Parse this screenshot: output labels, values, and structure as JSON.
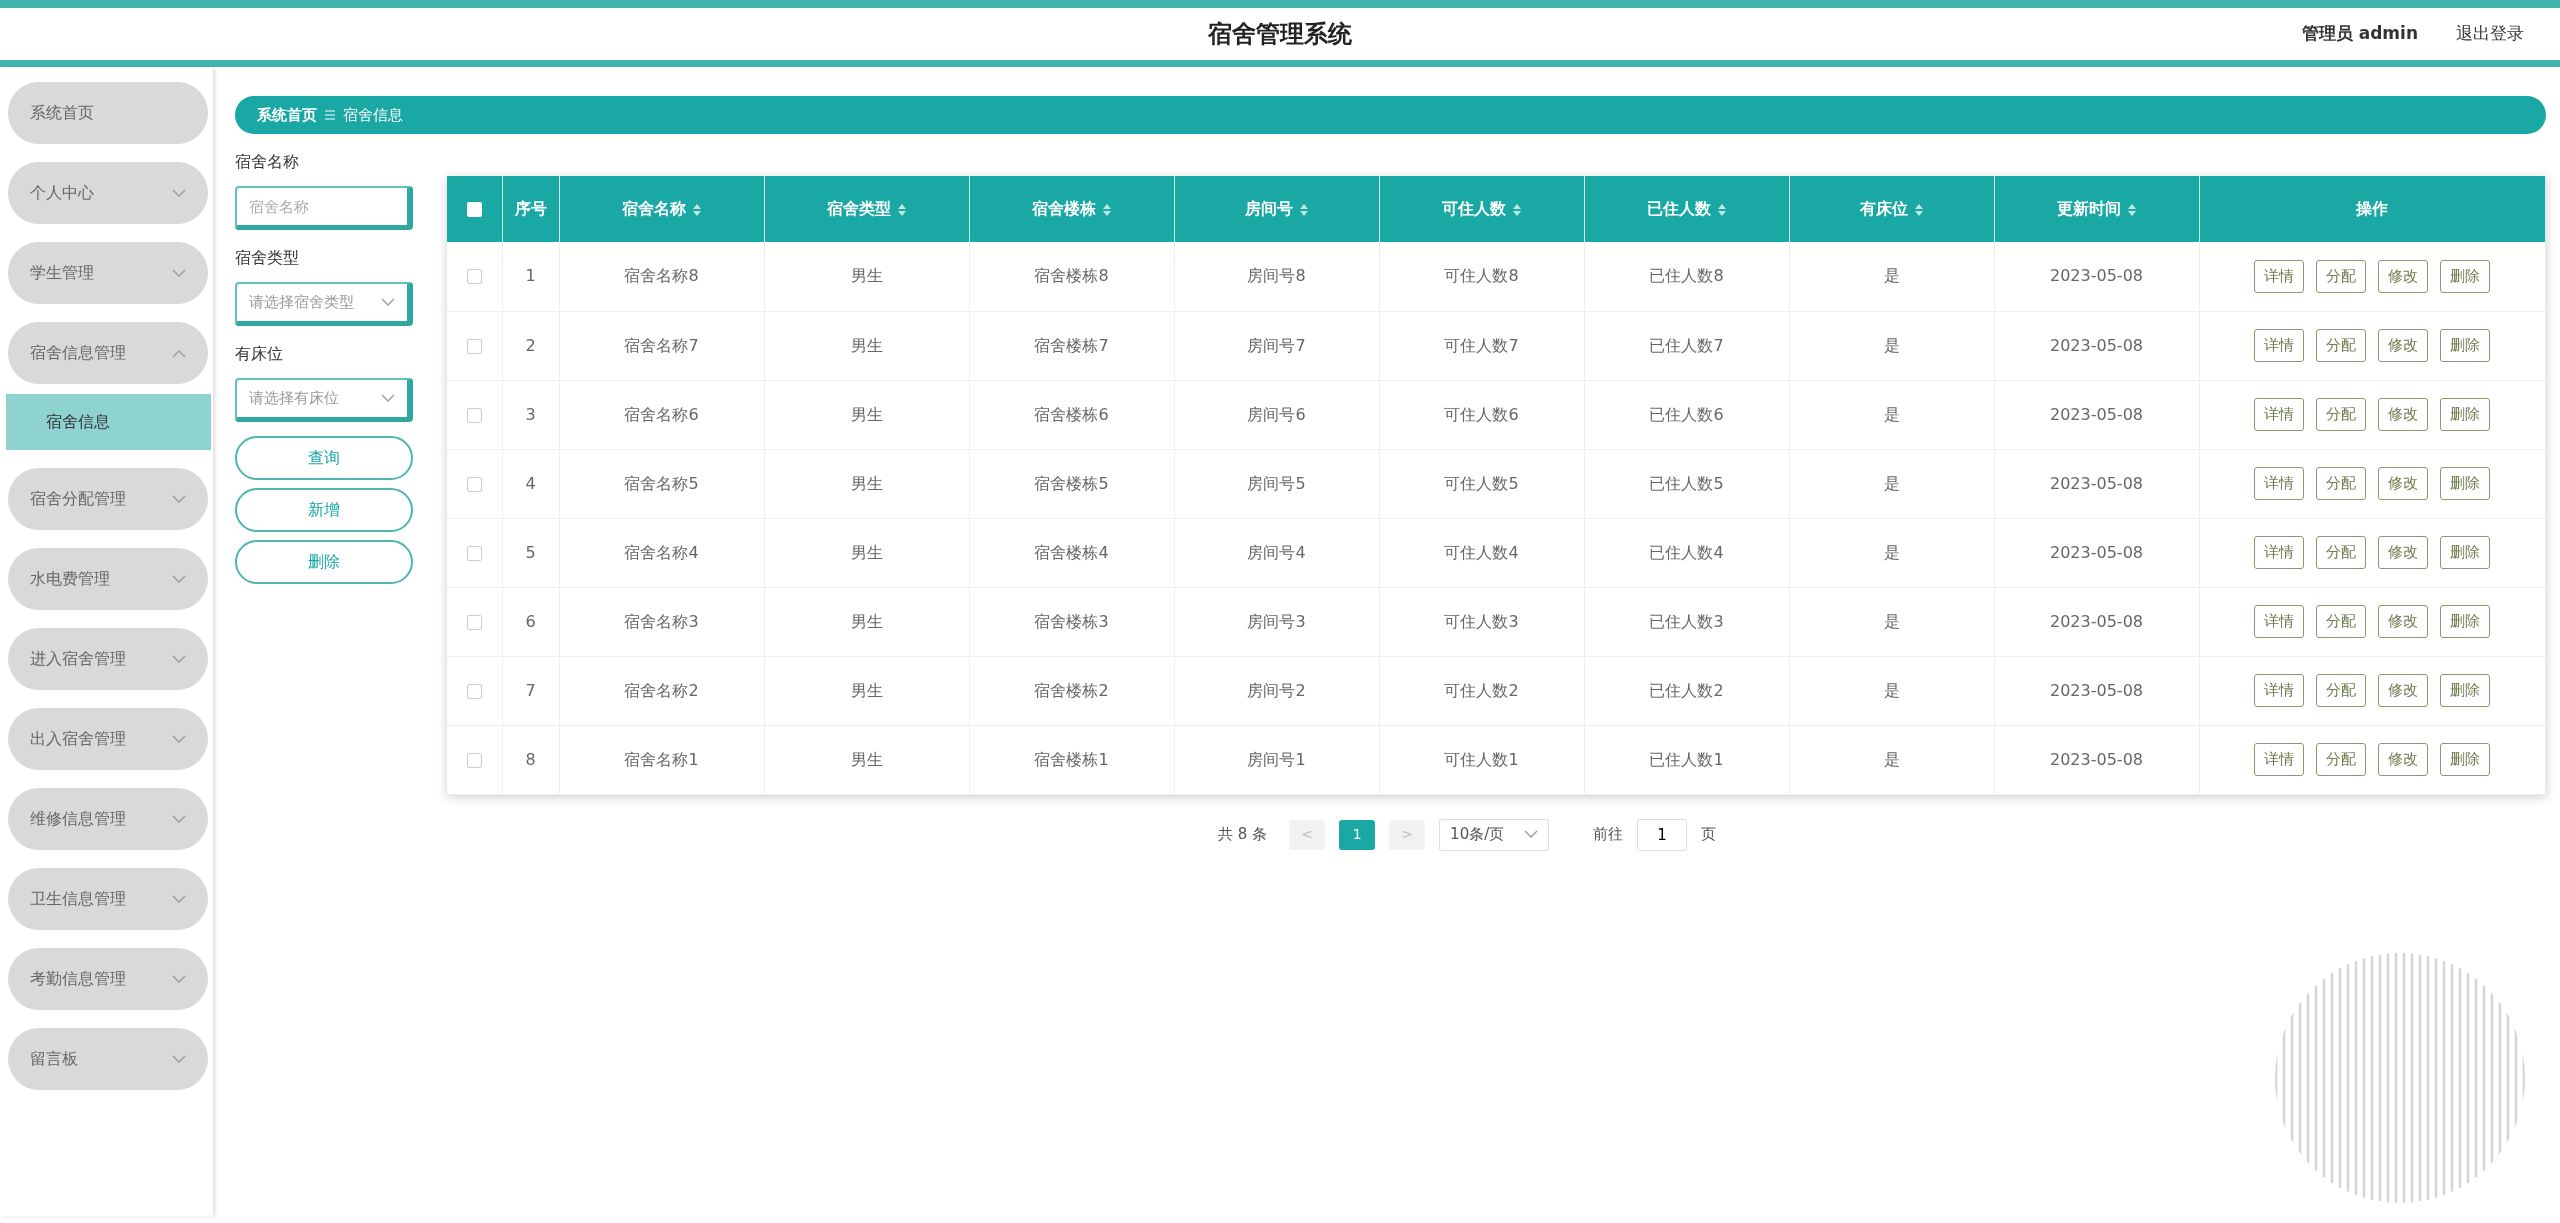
{
  "header": {
    "title": "宿舍管理系统",
    "user": "管理员 admin",
    "logout": "退出登录"
  },
  "sidebar": {
    "items": [
      {
        "label": "系统首页",
        "kind": "link"
      },
      {
        "label": "个人中心",
        "kind": "menu",
        "expanded": false
      },
      {
        "label": "学生管理",
        "kind": "menu",
        "expanded": false
      },
      {
        "label": "宿舍信息管理",
        "kind": "menu",
        "expanded": true,
        "children": [
          {
            "label": "宿舍信息",
            "selected": true
          }
        ]
      },
      {
        "label": "宿舍分配管理",
        "kind": "menu",
        "expanded": false
      },
      {
        "label": "水电费管理",
        "kind": "menu",
        "expanded": false
      },
      {
        "label": "进入宿舍管理",
        "kind": "menu",
        "expanded": false
      },
      {
        "label": "出入宿舍管理",
        "kind": "menu",
        "expanded": false
      },
      {
        "label": "维修信息管理",
        "kind": "menu",
        "expanded": false
      },
      {
        "label": "卫生信息管理",
        "kind": "menu",
        "expanded": false
      },
      {
        "label": "考勤信息管理",
        "kind": "menu",
        "expanded": false
      },
      {
        "label": "留言板",
        "kind": "menu",
        "expanded": false
      }
    ]
  },
  "breadcrumb": [
    "系统首页",
    "宿舍信息"
  ],
  "filters": [
    {
      "label": "宿舍名称",
      "kind": "input",
      "placeholder": "宿舍名称"
    },
    {
      "label": "宿舍类型",
      "kind": "select",
      "placeholder": "请选择宿舍类型"
    },
    {
      "label": "有床位",
      "kind": "select",
      "placeholder": "请选择有床位"
    }
  ],
  "filter_buttons": [
    "查询",
    "新增",
    "删除"
  ],
  "table": {
    "select_all": false,
    "columns": [
      {
        "label": "序号",
        "sortable": false
      },
      {
        "label": "宿舍名称",
        "sortable": true
      },
      {
        "label": "宿舍类型",
        "sortable": true
      },
      {
        "label": "宿舍楼栋",
        "sortable": true
      },
      {
        "label": "房间号",
        "sortable": true
      },
      {
        "label": "可住人数",
        "sortable": true
      },
      {
        "label": "已住人数",
        "sortable": true
      },
      {
        "label": "有床位",
        "sortable": true
      },
      {
        "label": "更新时间",
        "sortable": true
      },
      {
        "label": "操作",
        "sortable": false
      }
    ],
    "rows": [
      {
        "checked": false,
        "cells": [
          "1",
          "宿舍名称8",
          "男生",
          "宿舍楼栋8",
          "房间号8",
          "可住人数8",
          "已住人数8",
          "是",
          "2023-05-08"
        ],
        "actions": [
          "详情",
          "分配",
          "修改",
          "删除"
        ]
      },
      {
        "checked": false,
        "cells": [
          "2",
          "宿舍名称7",
          "男生",
          "宿舍楼栋7",
          "房间号7",
          "可住人数7",
          "已住人数7",
          "是",
          "2023-05-08"
        ],
        "actions": [
          "详情",
          "分配",
          "修改",
          "删除"
        ]
      },
      {
        "checked": false,
        "cells": [
          "3",
          "宿舍名称6",
          "男生",
          "宿舍楼栋6",
          "房间号6",
          "可住人数6",
          "已住人数6",
          "是",
          "2023-05-08"
        ],
        "actions": [
          "详情",
          "分配",
          "修改",
          "删除"
        ]
      },
      {
        "checked": false,
        "cells": [
          "4",
          "宿舍名称5",
          "男生",
          "宿舍楼栋5",
          "房间号5",
          "可住人数5",
          "已住人数5",
          "是",
          "2023-05-08"
        ],
        "actions": [
          "详情",
          "分配",
          "修改",
          "删除"
        ]
      },
      {
        "checked": false,
        "cells": [
          "5",
          "宿舍名称4",
          "男生",
          "宿舍楼栋4",
          "房间号4",
          "可住人数4",
          "已住人数4",
          "是",
          "2023-05-08"
        ],
        "actions": [
          "详情",
          "分配",
          "修改",
          "删除"
        ]
      },
      {
        "checked": false,
        "cells": [
          "6",
          "宿舍名称3",
          "男生",
          "宿舍楼栋3",
          "房间号3",
          "可住人数3",
          "已住人数3",
          "是",
          "2023-05-08"
        ],
        "actions": [
          "详情",
          "分配",
          "修改",
          "删除"
        ]
      },
      {
        "checked": false,
        "cells": [
          "7",
          "宿舍名称2",
          "男生",
          "宿舍楼栋2",
          "房间号2",
          "可住人数2",
          "已住人数2",
          "是",
          "2023-05-08"
        ],
        "actions": [
          "详情",
          "分配",
          "修改",
          "删除"
        ]
      },
      {
        "checked": false,
        "cells": [
          "8",
          "宿舍名称1",
          "男生",
          "宿舍楼栋1",
          "房间号1",
          "可住人数1",
          "已住人数1",
          "是",
          "2023-05-08"
        ],
        "actions": [
          "详情",
          "分配",
          "修改",
          "删除"
        ]
      }
    ]
  },
  "pagination": {
    "total": "共 8 条",
    "prev": "<",
    "pages": [
      {
        "label": "1",
        "selected": true
      }
    ],
    "next": ">",
    "page_size": "10条/页",
    "goto": "前往",
    "page_value": "1",
    "page_suffix": "页"
  }
}
